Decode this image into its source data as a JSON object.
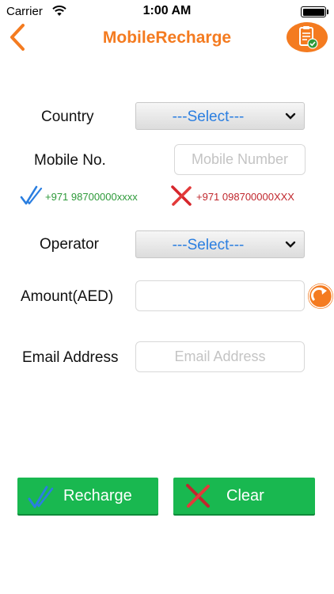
{
  "status_bar": {
    "carrier": "Carrier",
    "time": "1:00 AM",
    "icons": [
      "wifi-icon",
      "battery-icon"
    ]
  },
  "nav": {
    "title": "MobileRecharge",
    "back_icon": "chevron-left-icon",
    "history_icon": "clipboard-check-icon"
  },
  "form": {
    "country_label": "Country",
    "country_selected": "---Select---",
    "mobile_label": "Mobile No.",
    "mobile_value": "",
    "mobile_placeholder": "Mobile Number",
    "valid_example": "+971 98700000xxxx",
    "invalid_example": "+971 098700000XXX",
    "operator_label": "Operator",
    "operator_selected": "---Select---",
    "amount_label": "Amount(AED)",
    "amount_value": "",
    "amount_placeholder": "",
    "email_label": "Email Address",
    "email_value": "",
    "email_placeholder": "Email Address"
  },
  "actions": {
    "recharge_label": "Recharge",
    "clear_label": "Clear"
  },
  "colors": {
    "accent": "#f47b20",
    "button_green": "#19b850",
    "valid_green": "#2e9a3a",
    "invalid_red": "#c0272d",
    "select_text_blue": "#2a7ee0"
  }
}
